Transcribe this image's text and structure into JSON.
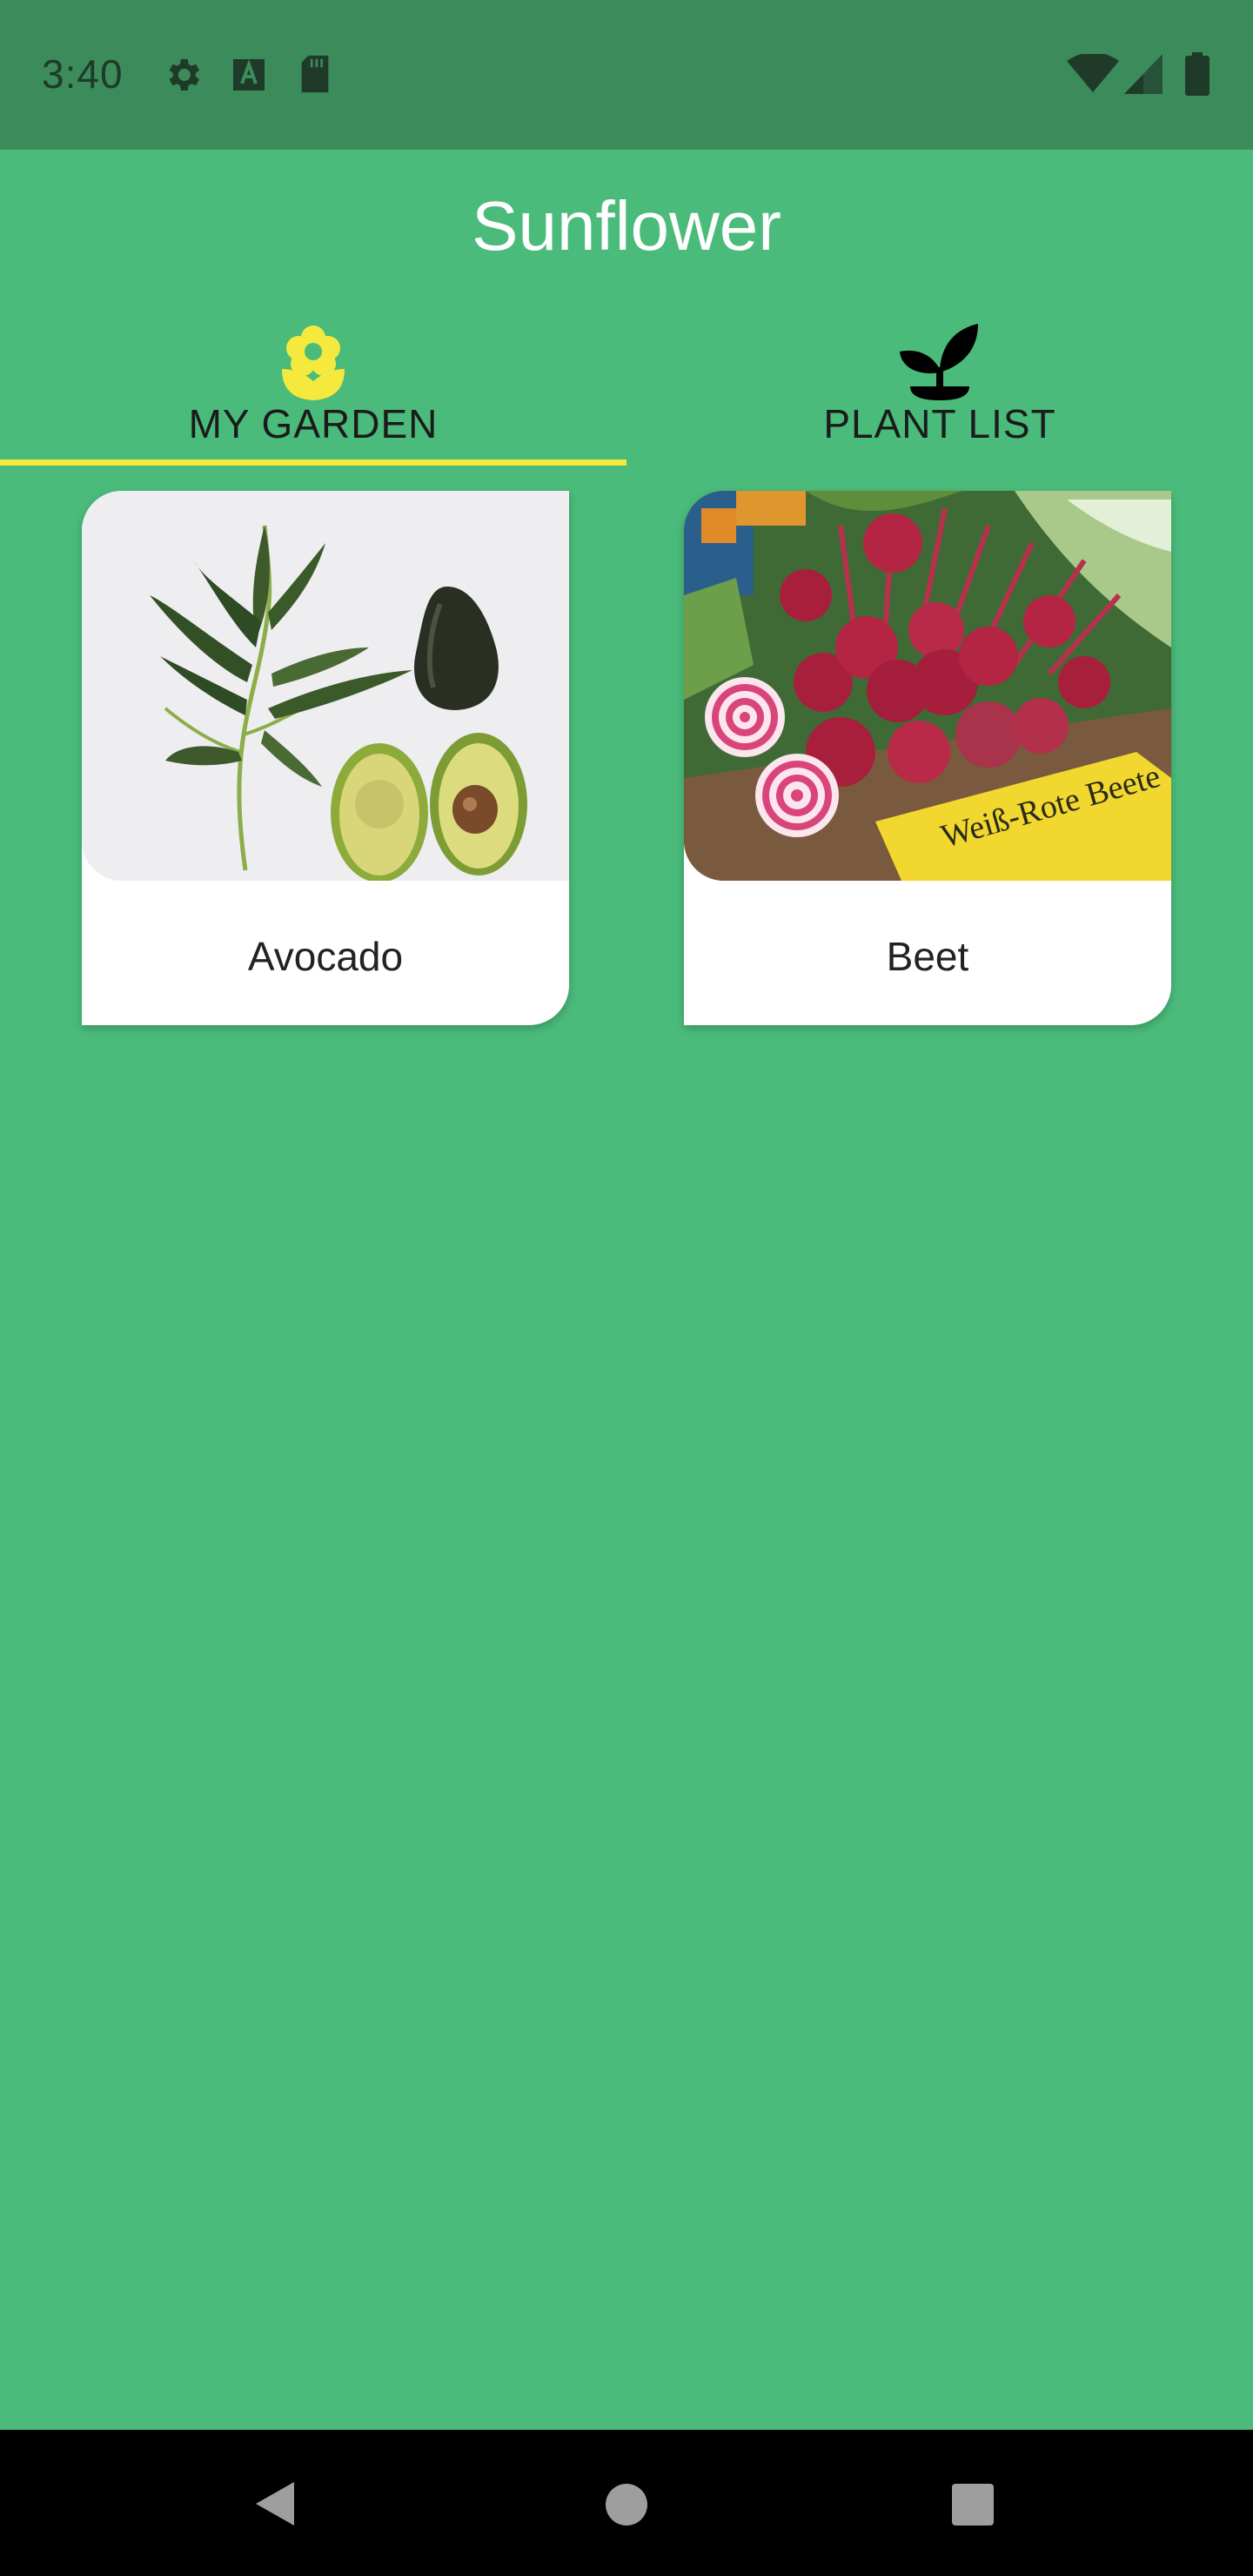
{
  "status_bar": {
    "time": "3:40",
    "icons_left": [
      "gear-icon",
      "keyboard-a-icon",
      "sd-card-icon"
    ],
    "icons_right": [
      "wifi-icon",
      "signal-icon",
      "battery-icon"
    ]
  },
  "app_bar": {
    "title": "Sunflower"
  },
  "tabs": [
    {
      "label": "MY GARDEN",
      "icon": "flower-icon",
      "selected": true
    },
    {
      "label": "PLANT LIST",
      "icon": "sprout-icon",
      "selected": false
    }
  ],
  "garden": {
    "plants": [
      {
        "name": "Avocado",
        "image": "avocado-photo"
      },
      {
        "name": "Beet",
        "image": "beet-photo"
      }
    ],
    "beet_sign": "Weiß-Rote Beete"
  },
  "nav_bar": {
    "buttons": [
      "back-icon",
      "home-icon",
      "recents-icon"
    ]
  },
  "colors": {
    "background": "#4bbb7b",
    "status_bar": "#3b8b5b",
    "tab_indicator": "#f4e93c",
    "selected_icon": "#f4e93c",
    "card": "#ffffff"
  }
}
